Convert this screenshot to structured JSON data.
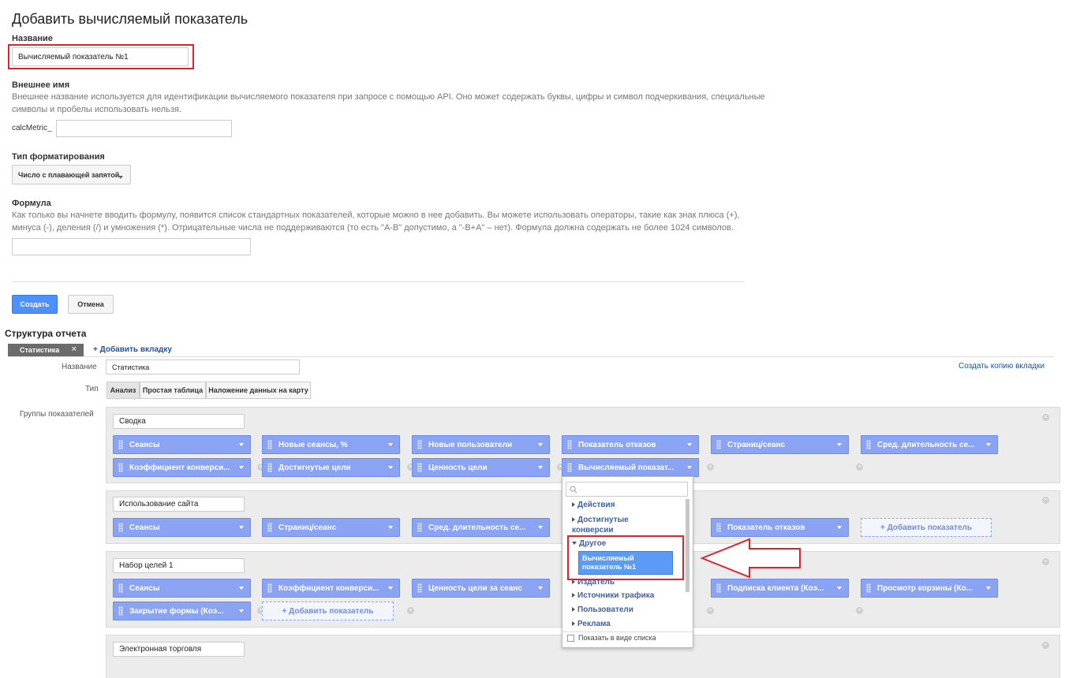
{
  "form": {
    "title": "Добавить вычисляемый показатель",
    "name_label": "Название",
    "name_value": "Вычисляемый показатель №1",
    "external_label": "Внешнее имя",
    "external_help_1": "Внешнее название используется для идентификации вычисляемого показателя при запросе с помощью API. Оно может содержать буквы, цифры и символ подчеркивания, специальные",
    "external_help_2": "символы и пробелы использовать нельзя.",
    "external_prefix": "calcMetric_",
    "external_value": "",
    "format_label": "Тип форматирования",
    "format_value": "Число с плавающей запятой",
    "formula_label": "Формула",
    "formula_help_1": "Как только вы начнете вводить формулу, появится список стандартных показателей, которые можно в нее добавить. Вы можете использовать операторы, такие как знак плюса (+),",
    "formula_help_2": "минуса (-), деления (/) и умножения (*). Отрицательные числа не поддерживаются (то есть \"A-B\" допустимо, а \"-B+A\" – нет). Формула должна содержать не более 1024 символов.",
    "formula_value": "",
    "create_button": "Создать",
    "cancel_button": "Отмена"
  },
  "report": {
    "title": "Структура отчета",
    "tab_label": "Статистика",
    "add_tab": "+ Добавить вкладку",
    "name_label": "Название",
    "name_value": "Статистика",
    "copy_tab": "Создать копию вкладки",
    "type_label": "Тип",
    "types": [
      "Анализ",
      "Простая таблица",
      "Наложение данных на карту"
    ],
    "groups_label": "Группы показателей",
    "add_metric": "+ Добавить показатель",
    "groups": [
      {
        "name": "Сводка",
        "row1": [
          "Сеансы",
          "Новые сеансы, %",
          "Новые пользователи",
          "Показатель отказов",
          "Страниц/сеанс",
          "Сред. длительность се..."
        ],
        "row2": [
          "Коэффициент конверси...",
          "Достигнутые цели",
          "Ценность цели",
          "Вычисляемый показат..."
        ]
      },
      {
        "name": "Использование сайта",
        "row1": [
          "Сеансы",
          "Страниц/сеанс",
          "Сред. длительность се...",
          "Показатель отказов"
        ]
      },
      {
        "name": "Набор целей 1",
        "row1": [
          "Сеансы",
          "Коэффициент конверси...",
          "Ценность цели за сеанс",
          "Подписка клиента (Коэ...",
          "Просмотр корзины (Ко..."
        ],
        "row2": [
          "Закрытие формы (Коэ..."
        ]
      },
      {
        "name": "Электронная торговля"
      }
    ]
  },
  "dropdown": {
    "search_value": "",
    "items": [
      "Действия",
      "Достигнутые конверсии",
      "Другое",
      "Издатель",
      "Источники трафика",
      "Пользователи",
      "Реклама"
    ],
    "selected": "Вычисляемый показатель №1",
    "show_list": "Показать в виде списка"
  },
  "colors": {
    "pill": "#8aa4f3",
    "highlight": "#e0232a",
    "primary_button": "#4d90fe",
    "link": "#1a55a5"
  }
}
